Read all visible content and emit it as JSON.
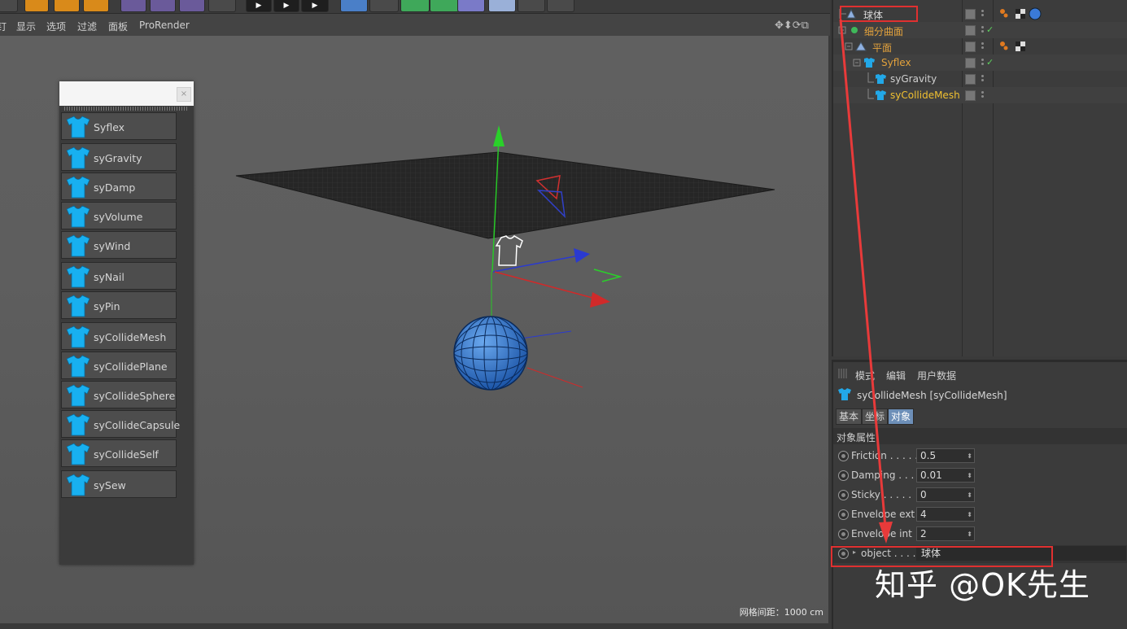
{
  "menubar": {
    "items": [
      "钉",
      "显示",
      "选项",
      "过滤",
      "面板",
      "ProRender"
    ]
  },
  "viewport": {
    "grid_spacing": "网格间距：1000 cm"
  },
  "palette": {
    "tools": [
      "Syflex",
      "syGravity",
      "syDamp",
      "syVolume",
      "syWind",
      "syNail",
      "syPin",
      "syCollideMesh",
      "syCollidePlane",
      "syCollideSphere",
      "syCollideCapsule",
      "syCollideSelf",
      "sySew"
    ],
    "icon": "shirt-icon"
  },
  "object_manager": {
    "objects": [
      {
        "name": "球体",
        "color": "#d8d8d8"
      },
      {
        "name": "细分曲面",
        "color": "#e3a23c"
      },
      {
        "name": "平面",
        "color": "#e3a23c"
      },
      {
        "name": "Syflex",
        "color": "#e3a23c"
      },
      {
        "name": "syGravity",
        "color": "#d0d0d0"
      },
      {
        "name": "syCollideMesh",
        "color": "#f0c030"
      }
    ]
  },
  "attribute_manager": {
    "menu": [
      "模式",
      "编辑",
      "用户数据"
    ],
    "title": "syCollideMesh [syCollideMesh]",
    "tabs": [
      "基本",
      "坐标",
      "对象"
    ],
    "active_tab": "对象",
    "section": "对象属性",
    "params": [
      {
        "label": "Friction . . . . .",
        "value": "0.5"
      },
      {
        "label": "Damping . . .",
        "value": "0.01"
      },
      {
        "label": "Sticky . . . . .",
        "value": "0"
      },
      {
        "label": "Envelope ext",
        "value": "4"
      },
      {
        "label": "Envelope int",
        "value": "2"
      }
    ],
    "object_link": {
      "label": "object . . . .",
      "value": "球体"
    }
  },
  "watermark": "知乎 @OK先生"
}
